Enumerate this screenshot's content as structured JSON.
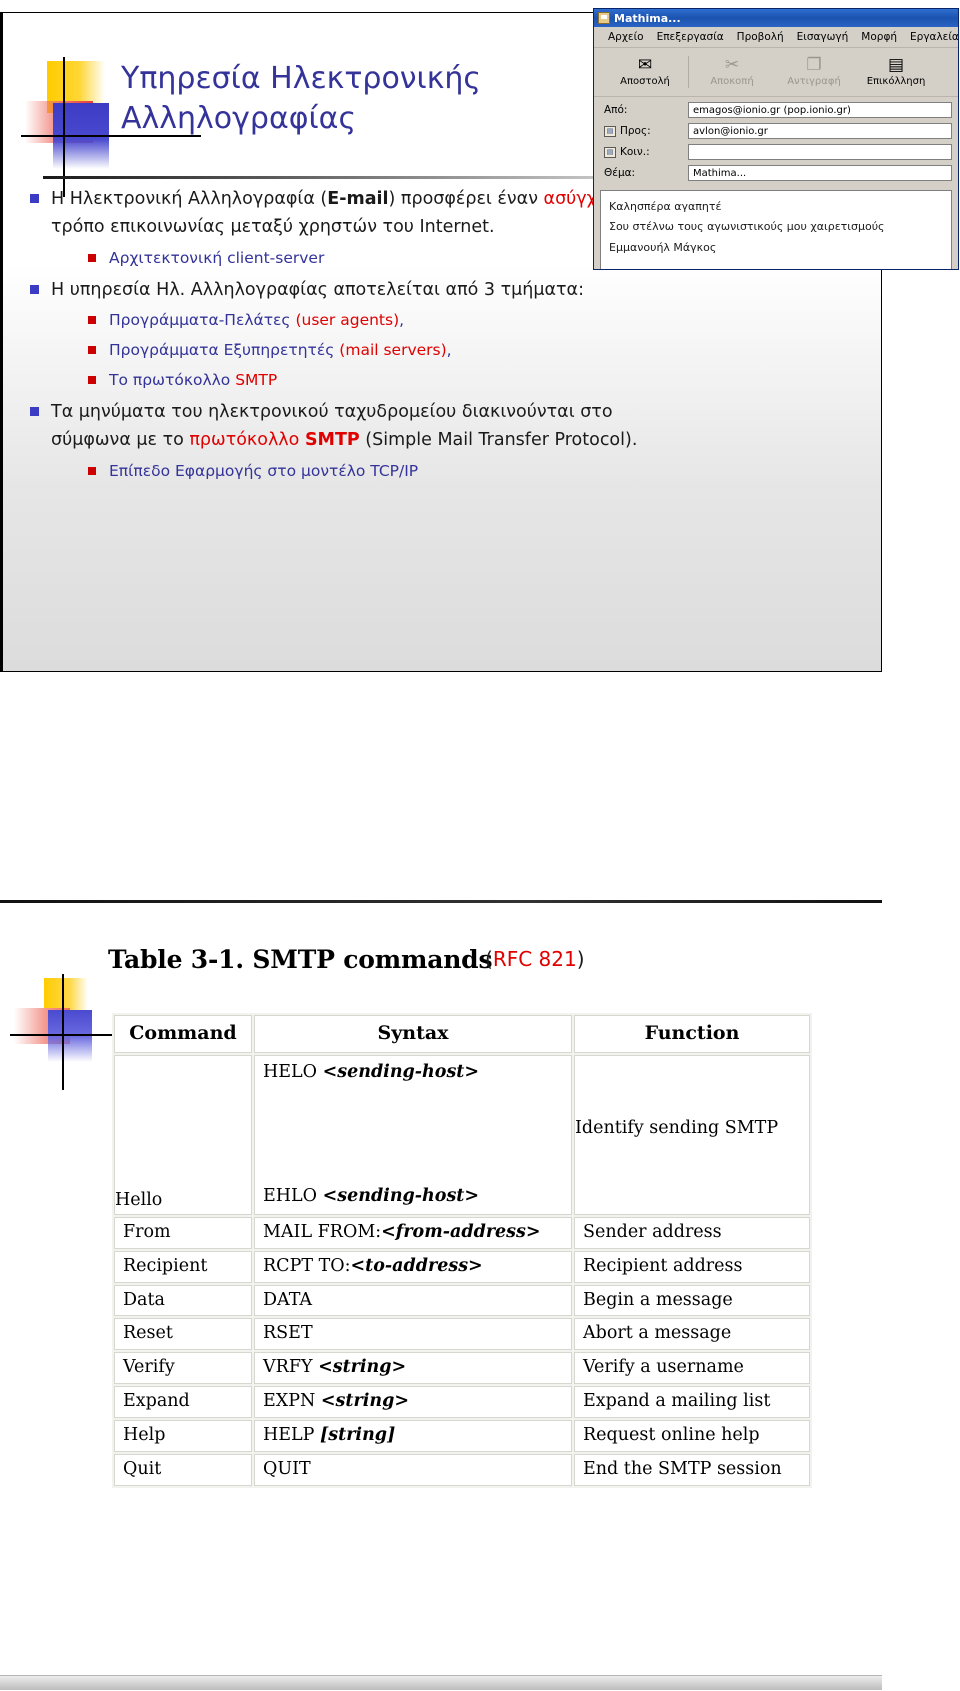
{
  "slide1": {
    "title": "Υπηρεσία Ηλεκτρονικής Αλληλογραφίας",
    "bullets": {
      "b1_part1": "Η Ηλεκτρονική Αλληλογραφία (",
      "b1_email": "E-mail",
      "b1_part2": ") προσφέρει έναν ",
      "b1_async": "ασύγχρονο",
      "b1_part3": " τρόπο επικοινωνίας μεταξύ χρηστών του Internet.",
      "b2": "Αρχιτεκτονική client-server",
      "b3": "Η υπηρεσία Ηλ. Αλληλογραφίας αποτελείται από 3 τμήματα:",
      "b4_part1": "Προγράμματα-Πελάτες ",
      "b4_red": "(user agents)",
      "b4_part2": ",",
      "b5_part1": "Προγράμματα Εξυπηρετητές ",
      "b5_red": "(mail servers)",
      "b5_part2": ",",
      "b6_part1": "Το πρωτόκολλο ",
      "b6_red": "SMTP",
      "b7_part1": "Τα μηνύματα του ηλεκτρονικού ταχυδρομείου διακινούνται στο σύμφωνα με το ",
      "b7_red1": "πρωτόκολλο ",
      "b7_red2": "SMTP",
      "b7_part2": " (Simple Mail Transfer Protocol).",
      "b8": "Επίπεδο Εφαρμογής στο μοντέλο TCP/IP"
    }
  },
  "mail_window": {
    "title": "Mathima...",
    "menu": [
      "Αρχείο",
      "Επεξεργασία",
      "Προβολή",
      "Εισαγωγή",
      "Μορφή",
      "Εργαλεία"
    ],
    "toolbar": [
      {
        "label": "Αποστολή",
        "icon": "send-icon",
        "glyph": "✉",
        "enabled": true
      },
      {
        "label": "Αποκοπή",
        "icon": "scissors-icon",
        "glyph": "✂",
        "enabled": false
      },
      {
        "label": "Αντιγραφή",
        "icon": "copy-icon",
        "glyph": "❐",
        "enabled": false
      },
      {
        "label": "Επικόλληση",
        "icon": "paste-icon",
        "glyph": "📋",
        "enabled": true
      }
    ],
    "fields": [
      {
        "label": "Από:",
        "value": "emagos@ionio.gr    (pop.ionio.gr)",
        "has_addr_icon": false
      },
      {
        "label": "Προς:",
        "value": "avlon@ionio.gr",
        "has_addr_icon": true
      },
      {
        "label": "Κοιν.:",
        "value": "",
        "has_addr_icon": true
      },
      {
        "label": "Θέμα:",
        "value": "Mathima...",
        "has_addr_icon": false
      }
    ],
    "body": [
      "Καλησπέρα αγαπητέ",
      "Σου στέλνω τους αγωνιστικούς μου χαιρετισμούς",
      "Εμμανουήλ Μάγκος"
    ]
  },
  "slide2": {
    "caption": "Table 3-1. SMTP commands",
    "rfc_open": "(",
    "rfc_label": "RFC 821",
    "rfc_close": ")",
    "headers": [
      "Command",
      "Syntax",
      "Function"
    ],
    "rows": [
      {
        "command": "Hello",
        "syntax_line1_cmd": "HELO ",
        "syntax_line1_arg": "<sending-host>",
        "syntax_line2_cmd": "EHLO ",
        "syntax_line2_arg": "<sending-host>",
        "function": "Identify sending SMTP"
      },
      {
        "command": "From",
        "syntax_cmd": "MAIL FROM:",
        "syntax_arg": "<from-address>",
        "function": "Sender address"
      },
      {
        "command": "Recipient",
        "syntax_cmd": "RCPT TO:",
        "syntax_arg": "<to-address>",
        "function": "Recipient address"
      },
      {
        "command": "Data",
        "syntax_cmd": "DATA",
        "syntax_arg": "",
        "function": "Begin a message"
      },
      {
        "command": "Reset",
        "syntax_cmd": "RSET",
        "syntax_arg": "",
        "function": "Abort a message"
      },
      {
        "command": "Verify",
        "syntax_cmd": "VRFY ",
        "syntax_arg": "<string>",
        "function": "Verify a username"
      },
      {
        "command": "Expand",
        "syntax_cmd": "EXPN ",
        "syntax_arg": "<string>",
        "function": "Expand a mailing list"
      },
      {
        "command": "Help",
        "syntax_cmd": "HELP ",
        "syntax_arg": "[string]",
        "function": "Request online help"
      },
      {
        "command": "Quit",
        "syntax_cmd": "QUIT",
        "syntax_arg": "",
        "function": "End the SMTP session"
      }
    ]
  },
  "colors": {
    "title_blue": "#333399",
    "accent_red": "#e00000",
    "bullet_blue": "#3b3bc4",
    "bullet_red": "#cc0000"
  }
}
